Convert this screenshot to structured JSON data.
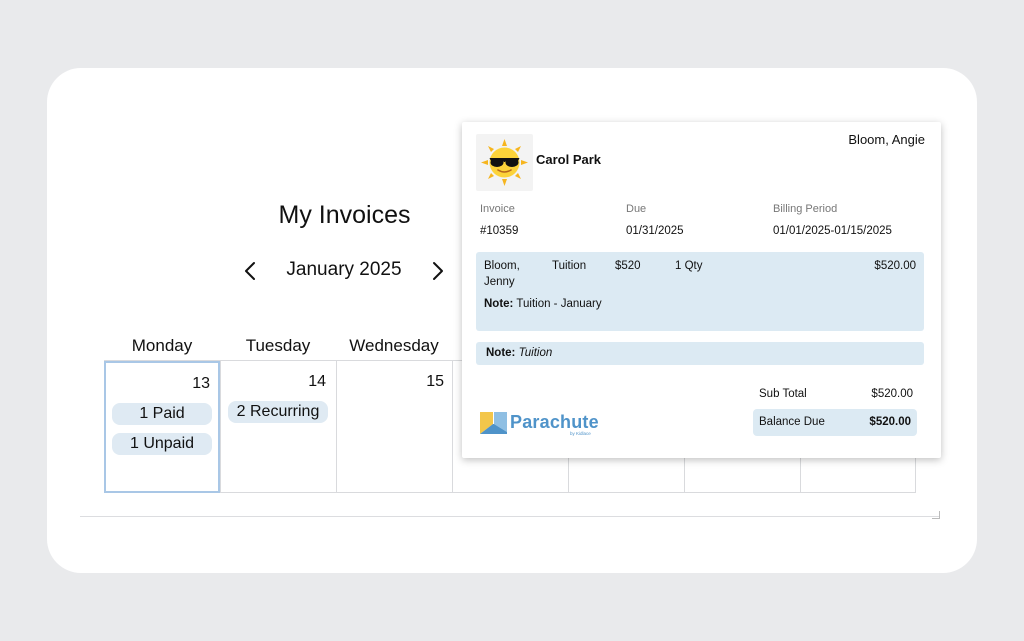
{
  "page": {
    "title": "My Invoices",
    "month": "January 2025"
  },
  "calendar": {
    "day_headers": [
      "Monday",
      "Tuesday",
      "Wednesday"
    ],
    "cells": [
      {
        "date": "13",
        "pills": [
          "1 Paid",
          "1 Unpaid"
        ],
        "selected": true
      },
      {
        "date": "14",
        "pills": [
          "2 Recurring"
        ],
        "selected": false
      },
      {
        "date": "15",
        "pills": [],
        "selected": false
      }
    ]
  },
  "invoice_popup": {
    "student_name": "Carol Park",
    "parent_name": "Bloom, Angie",
    "labels": {
      "invoice": "Invoice",
      "due": "Due",
      "billing_period": "Billing Period"
    },
    "invoice_number": "#10359",
    "due_date": "01/31/2025",
    "billing_period": "01/01/2025-01/15/2025",
    "line_item": {
      "name_line1": "Bloom,",
      "name_line2": "Jenny",
      "type": "Tuition",
      "price": "$520",
      "qty": "1 Qty",
      "total": "$520.00",
      "note_label": "Note:",
      "note_text": "Tuition - January"
    },
    "invoice_note": {
      "label": "Note:",
      "text": "Tuition"
    },
    "sub_total_label": "Sub Total",
    "sub_total_value": "$520.00",
    "balance_due_label": "Balance Due",
    "balance_due_value": "$520.00",
    "logo": {
      "text": "Parachute",
      "subtext": "by Kidlace"
    }
  },
  "colors": {
    "accent": "#4f93c9",
    "pill_bg": "#dfeaf3",
    "highlight_bg": "#dceaf3",
    "selected_border": "#a9c7e6",
    "page_bg": "#e9eaec"
  },
  "icons": [
    "chevron-left-icon",
    "chevron-right-icon",
    "sun-sunglasses-avatar-icon",
    "parachute-logo-icon"
  ]
}
